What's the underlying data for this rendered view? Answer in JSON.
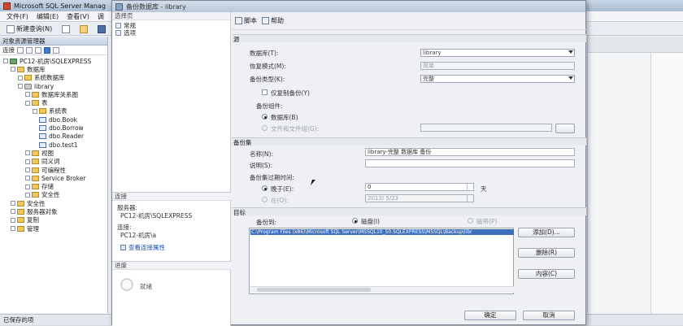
{
  "main": {
    "title": "Microsoft SQL Server Manag",
    "menu": [
      "文件(F)",
      "编辑(E)",
      "查看(V)",
      "调"
    ],
    "toolbar_new_query": "新建查询(N)",
    "oe_title": "对象资源管理器",
    "oe_connect": "连接",
    "tree": [
      {
        "label": "PC12-机房\\SQLEXPRESS",
        "icon": "server-icon",
        "indent": 0
      },
      {
        "label": "数据库",
        "icon": "folder-icon",
        "indent": 1
      },
      {
        "label": "系统数据库",
        "icon": "folder-icon",
        "indent": 2
      },
      {
        "label": "library",
        "icon": "database-icon",
        "indent": 2
      },
      {
        "label": "数据库关系图",
        "icon": "folder-icon",
        "indent": 3
      },
      {
        "label": "表",
        "icon": "folder-icon",
        "indent": 3
      },
      {
        "label": "系统表",
        "icon": "folder-icon",
        "indent": 4
      },
      {
        "label": "dbo.Book",
        "icon": "table-icon",
        "indent": 4
      },
      {
        "label": "dbo.Borrow",
        "icon": "table-icon",
        "indent": 4
      },
      {
        "label": "dbo.Reader",
        "icon": "table-icon",
        "indent": 4
      },
      {
        "label": "dbo.test1",
        "icon": "table-icon",
        "indent": 4
      },
      {
        "label": "视图",
        "icon": "folder-icon",
        "indent": 3
      },
      {
        "label": "同义词",
        "icon": "folder-icon",
        "indent": 3
      },
      {
        "label": "可编程性",
        "icon": "folder-icon",
        "indent": 3
      },
      {
        "label": "Service Broker",
        "icon": "folder-icon",
        "indent": 3
      },
      {
        "label": "存储",
        "icon": "folder-icon",
        "indent": 3
      },
      {
        "label": "安全性",
        "icon": "folder-icon",
        "indent": 3
      },
      {
        "label": "安全性",
        "icon": "folder-icon",
        "indent": 1
      },
      {
        "label": "服务器对象",
        "icon": "folder-icon",
        "indent": 1
      },
      {
        "label": "复制",
        "icon": "folder-icon",
        "indent": 1
      },
      {
        "label": "管理",
        "icon": "folder-icon",
        "indent": 1
      }
    ],
    "status": "已保存的项"
  },
  "dialog": {
    "title": "备份数据库 - library",
    "select_page_head": "选择页",
    "pages": [
      "常规",
      "选项"
    ],
    "toolbar": {
      "script": "脚本",
      "help": "帮助"
    },
    "connection_head": "连接",
    "connection_label": "服务器:",
    "connection_server": "PC12-机房\\SQLEXPRESS",
    "connection_conn_label": "连接:",
    "connection_user": "PC12-机房\\a",
    "view_conn_props": "查看连接属性",
    "progress_head": "进度",
    "progress_status": "就绪",
    "source": {
      "head": "源",
      "database_label": "数据库(T):",
      "database_value": "library",
      "recovery_label": "恢复模式(M):",
      "recovery_value": "简单",
      "backup_type_label": "备份类型(K):",
      "backup_type_value": "完整",
      "copy_only_label": "仅复制备份(Y)",
      "component_label": "备份组件:",
      "component_database": "数据库(B)",
      "component_files": "文件和文件组(G):"
    },
    "backup_set": {
      "head": "备份集",
      "name_label": "名称(N):",
      "name_value": "library-完整 数据库 备份",
      "desc_label": "说明(S):",
      "desc_value": "",
      "expire_label": "备份集过期时间:",
      "after_label": "晚于(E):",
      "after_value": "0",
      "days_unit": "天",
      "on_label": "在(O):",
      "on_value": "2013/ 5/23"
    },
    "destination": {
      "head": "目标",
      "backup_to_label": "备份到:",
      "disk_label": "磁盘(I)",
      "tape_label": "磁带(P)",
      "path": "C:\\Program Files (x86)\\Microsoft SQL Server\\MSSQL10_50.SQLEXPRESS\\MSSQL\\Backup\\libr",
      "add": "添加(D)...",
      "remove": "删除(R)",
      "contents": "内容(C)"
    },
    "ok": "确定",
    "cancel": "取消"
  }
}
